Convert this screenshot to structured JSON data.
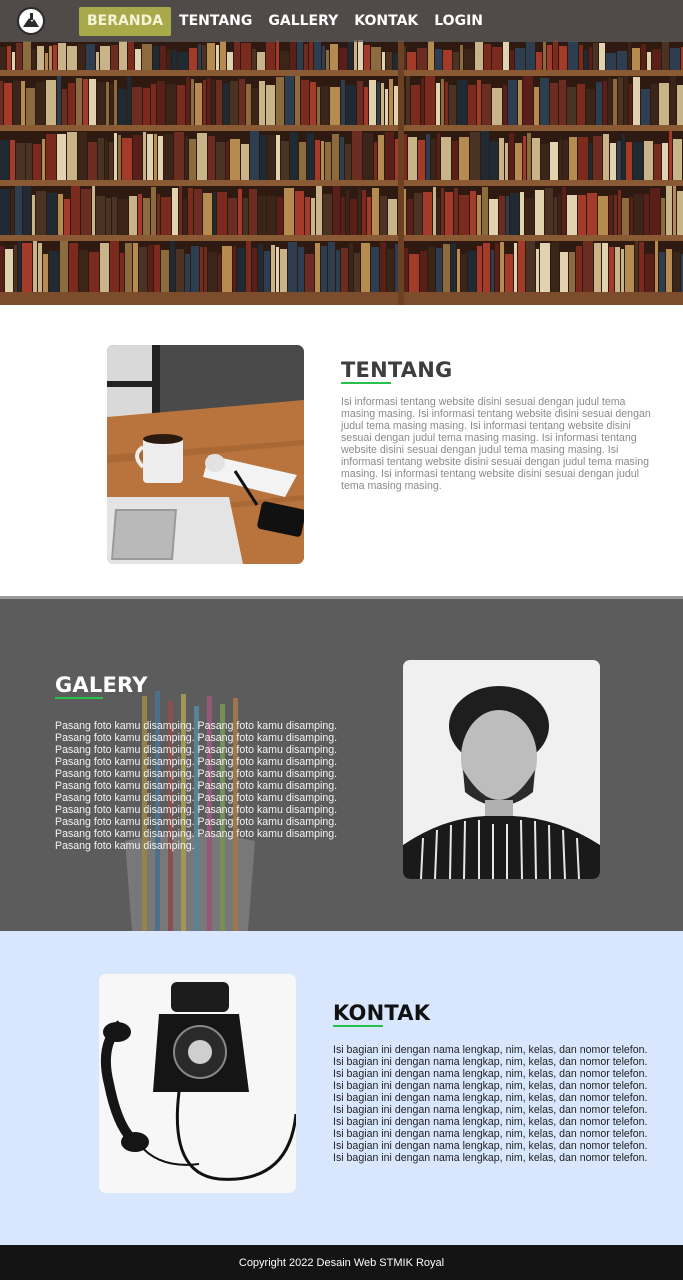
{
  "nav": {
    "logo_icon": "mountain-logo-icon",
    "items": [
      {
        "label": "BERANDA",
        "active": true
      },
      {
        "label": "TENTANG",
        "active": false
      },
      {
        "label": "GALLERY",
        "active": false
      },
      {
        "label": "KONTAK",
        "active": false
      },
      {
        "label": "LOGIN",
        "active": false
      }
    ]
  },
  "tentang": {
    "title": "TENTANG",
    "text": "Isi informasi tentang website disini sesuai dengan judul tema masing masing. Isi informasi tentang website disini sesuai dengan judul tema masing masing. Isi informasi tentang website disini sesuai dengan judul tema masing masing. Isi informasi tentang website disini sesuai dengan judul tema masing masing. Isi informasi tentang website disini sesuai dengan judul tema masing masing. Isi informasi tentang website disini sesuai dengan judul tema masing masing."
  },
  "galery": {
    "title": "GALERY",
    "text": "Pasang foto kamu disamping. Pasang foto kamu disamping. Pasang foto kamu disamping. Pasang foto kamu disamping. Pasang foto kamu disamping. Pasang foto kamu disamping. Pasang foto kamu disamping. Pasang foto kamu disamping. Pasang foto kamu disamping. Pasang foto kamu disamping. Pasang foto kamu disamping. Pasang foto kamu disamping. Pasang foto kamu disamping. Pasang foto kamu disamping. Pasang foto kamu disamping. Pasang foto kamu disamping. Pasang foto kamu disamping. Pasang foto kamu disamping. Pasang foto kamu disamping. Pasang foto kamu disamping. Pasang foto kamu disamping."
  },
  "kontak": {
    "title": "KONTAK",
    "lines": [
      "Isi bagian ini dengan nama lengkap, nim, kelas, dan nomor telefon.",
      "Isi bagian ini dengan nama lengkap, nim, kelas, dan nomor telefon.",
      "Isi bagian ini dengan nama lengkap, nim, kelas, dan nomor telefon.",
      "Isi bagian ini dengan nama lengkap, nim, kelas, dan nomor telefon.",
      "Isi bagian ini dengan nama lengkap, nim, kelas, dan nomor telefon.",
      "Isi bagian ini dengan nama lengkap, nim, kelas, dan nomor telefon.",
      "Isi bagian ini dengan nama lengkap, nim, kelas, dan nomor telefon.",
      "Isi bagian ini dengan nama lengkap, nim, kelas, dan nomor telefon.",
      "Isi bagian ini dengan nama lengkap, nim, kelas, dan nomor telefon.",
      "Isi bagian ini dengan nama lengkap, nim, kelas, dan nomor telefon."
    ]
  },
  "footer": {
    "text": "Copyright 2022 Desain Web STMIK Royal"
  },
  "colors": {
    "accent_line": "#26c24a",
    "nav_active": "#a7a94a",
    "kontak_bg": "#d8e7fd",
    "footer_bg": "#141414"
  }
}
